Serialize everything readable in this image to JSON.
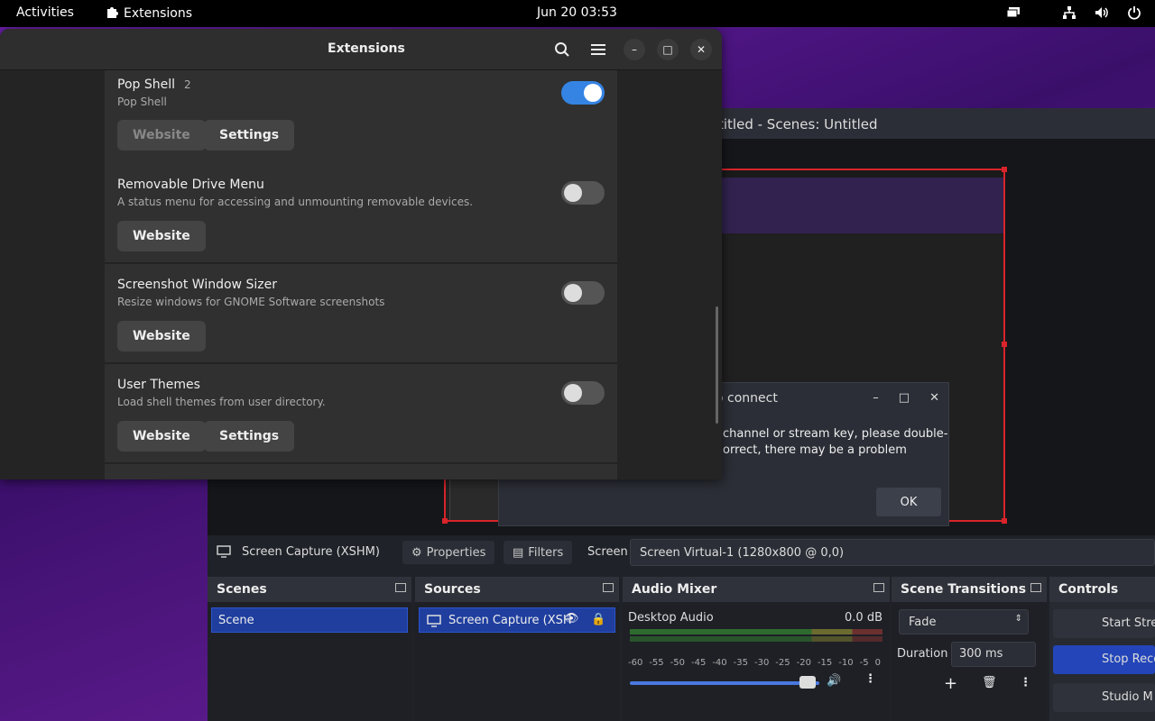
{
  "topbar": {
    "activities": "Activities",
    "app_menu": "Extensions",
    "clock": "Jun 20  03:53"
  },
  "extensions_window": {
    "title": "Extensions",
    "items": [
      {
        "name": "Pop Shell",
        "version": "2",
        "description": "Pop Shell",
        "enabled": true,
        "website": "Website",
        "settings": "Settings",
        "website_disabled": true
      },
      {
        "name": "Removable Drive Menu",
        "version": "",
        "description": "A status menu for accessing and unmounting removable devices.",
        "enabled": false,
        "website": "Website"
      },
      {
        "name": "Screenshot Window Sizer",
        "version": "",
        "description": "Resize windows for GNOME Software screenshots",
        "enabled": false,
        "website": "Website"
      },
      {
        "name": "User Themes",
        "version": "",
        "description": "Load shell themes from user directory.",
        "enabled": false,
        "website": "Website",
        "settings": "Settings"
      }
    ]
  },
  "obs": {
    "title": "titled - Scenes: Untitled",
    "dialog": {
      "title": "o connect",
      "line1": "channel or stream key, please double-",
      "line2": "orrect, there may be a problem",
      "ok": "OK"
    },
    "source_toolbar": {
      "source_name": "Screen Capture (XSHM)",
      "properties": "Properties",
      "filters": "Filters",
      "screen_label": "Screen",
      "screen_value": "Screen Virtual-1 (1280x800 @ 0,0)"
    },
    "docks": {
      "scenes": {
        "title": "Scenes",
        "items": [
          "Scene"
        ]
      },
      "sources": {
        "title": "Sources",
        "items": [
          "Screen Capture (XSH"
        ]
      },
      "audio_mixer": {
        "title": "Audio Mixer",
        "track": "Desktop Audio",
        "level": "0.0 dB",
        "ticks": [
          "-60",
          "-55",
          "-50",
          "-45",
          "-40",
          "-35",
          "-30",
          "-25",
          "-20",
          "-15",
          "-10",
          "-5",
          "0"
        ]
      },
      "transitions": {
        "title": "Scene Transitions",
        "transition": "Fade",
        "duration_label": "Duration",
        "duration_value": "300 ms"
      },
      "controls": {
        "title": "Controls",
        "buttons": [
          "Start Strea",
          "Stop Reco",
          "Studio M"
        ]
      }
    }
  },
  "colors": {
    "accent_blue": "#3584e4",
    "obs_selection": "#1f3e9e",
    "preview_border": "#d8242a"
  }
}
